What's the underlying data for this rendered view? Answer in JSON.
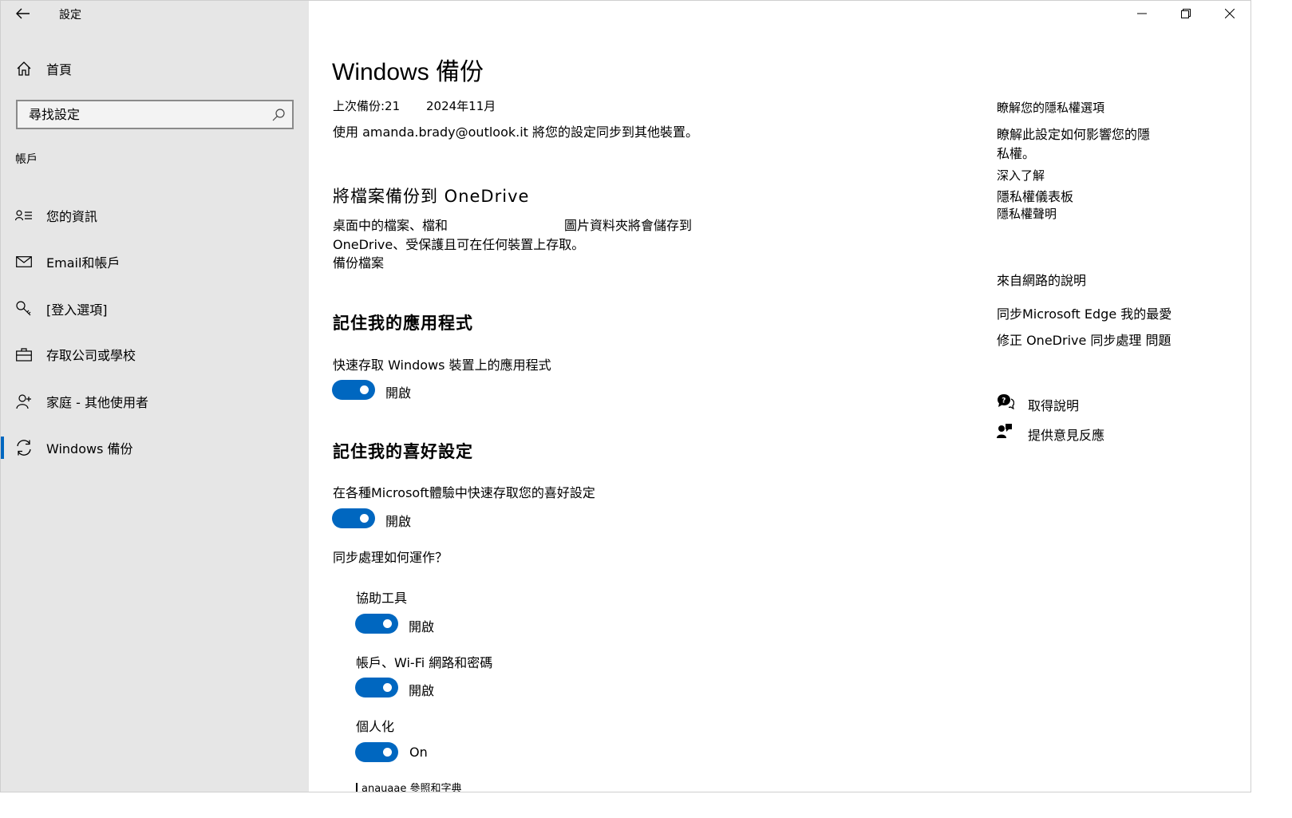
{
  "window": {
    "title": "設定",
    "controls": {
      "minimize": "minimize-icon",
      "maximize": "restore-icon",
      "close": "close-icon"
    }
  },
  "sidebar": {
    "home_label": "首頁",
    "search_placeholder": "尋找設定",
    "section_label": "帳戶",
    "items": [
      {
        "label": "您的資訊",
        "icon": "person-card-icon"
      },
      {
        "label": "Email和帳戶",
        "icon": "mail-icon"
      },
      {
        "label": "[登入選項]",
        "icon": "key-icon"
      },
      {
        "label": "存取公司或學校",
        "icon": "briefcase-icon"
      },
      {
        "label": "家庭 - 其他使用者",
        "icon": "add-person-icon"
      },
      {
        "label": "Windows 備份",
        "icon": "sync-icon",
        "selected": true
      }
    ],
    "accent_color": "#0067c0"
  },
  "main": {
    "title": "Windows 備份",
    "last_backup_label": "上次備份:21",
    "last_backup_date": "2024年11月",
    "sync_account_text": "使用 amanda.brady@outlook.it 將您的設定同步到其他裝置。",
    "onedrive": {
      "heading": "將檔案備份到 OneDrive",
      "desc_line1a": "桌面中的檔案、檔和",
      "desc_line1b": "圖片資料夾將會儲存到",
      "desc_line2": "OneDrive、受保護且可在任何裝置上存取。",
      "link": "備份檔案"
    },
    "apps": {
      "heading": "記住我的應用程式",
      "desc": "快速存取 Windows 裝置上的應用程式",
      "toggle_state": "開啟"
    },
    "prefs": {
      "heading": "記住我的喜好設定",
      "desc": "在各種Microsoft體驗中快速存取您的喜好設定",
      "toggle_state": "開啟",
      "how_link": "同步處理如何運作？",
      "sub": [
        {
          "label": "協助工具",
          "state": "開啟"
        },
        {
          "label": "帳戶、Wi-Fi 網路和密碼",
          "state": "開啟"
        },
        {
          "label": "個人化",
          "state": "On"
        }
      ],
      "cut_off_item": "anauaae 參照和字典"
    }
  },
  "right": {
    "privacy_heading": "瞭解您的隱私權選項",
    "privacy_desc_line1": "瞭解此設定如何影響您的隱",
    "privacy_desc_line2": "私權。",
    "links": [
      "深入了解",
      "隱私權儀表板",
      "隱私權聲明"
    ],
    "web_help_heading": "來自網路的說明",
    "web_links": [
      "同步Microsoft Edge 我的最愛",
      "修正 OneDrive 同步處理 問題"
    ],
    "get_help": "取得說明",
    "feedback": "提供意見反應"
  }
}
